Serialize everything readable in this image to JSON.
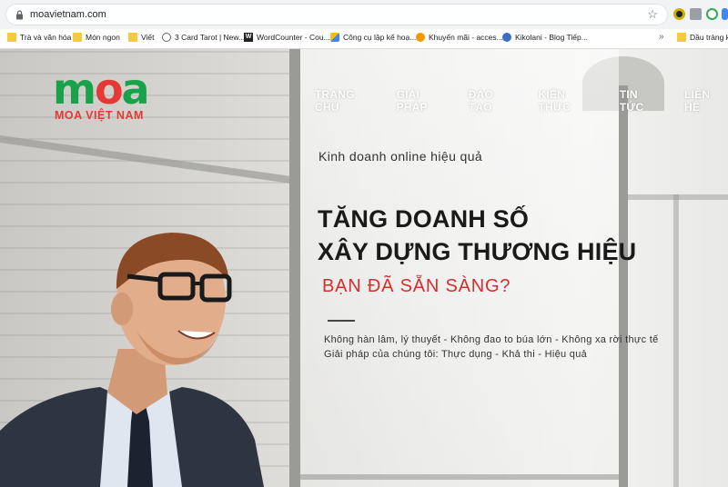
{
  "browser": {
    "url": "moavietnam.com",
    "bookmarks": [
      {
        "label": "Trà và văn hóa",
        "icon": "folder-icon"
      },
      {
        "label": "Món ngon",
        "icon": "folder-icon"
      },
      {
        "label": "Viết",
        "icon": "folder-icon"
      },
      {
        "label": "3 Card Tarot | New...",
        "icon": "globe-icon"
      },
      {
        "label": "WordCounter - Cou...",
        "icon": "w-icon"
      },
      {
        "label": "Công cụ lập kế hoạ...",
        "icon": "google-ads-icon"
      },
      {
        "label": "Khuyến mãi - acces...",
        "icon": "accesstrade-icon"
      },
      {
        "label": "Kikolani - Blog Tiếp...",
        "icon": "kikolani-icon"
      },
      {
        "label": "Dầu tràng kỉ",
        "icon": "folder-icon"
      }
    ],
    "more_label": "»"
  },
  "site": {
    "logo_mark": {
      "m": "m",
      "o": "o",
      "a": "a"
    },
    "logo_text": "MOA VIỆT NAM",
    "nav": [
      "TRANG CHỦ",
      "GIẢI PHÁP",
      "ĐÀO TẠO",
      "KIẾN THỨC",
      "TIN TỨC",
      "LIÊN HỆ"
    ]
  },
  "hero": {
    "tagline": "Kinh doanh online hiệu quả",
    "headline_1": "TĂNG DOANH SỐ",
    "headline_2": "XÂY DỰNG THƯƠNG HIỆU",
    "ready": "BẠN ĐÃ SẴN SÀNG?",
    "desc_1": "Không hàn lâm, lý thuyết - Không đao to búa lớn - Không xa rời thực tế",
    "desc_2": "Giải pháp của chúng tôi: Thực dụng - Khả thi - Hiệu quả"
  },
  "colors": {
    "brand_green": "#1aa24a",
    "brand_red": "#e53935",
    "ready_red": "#d32f2f"
  }
}
